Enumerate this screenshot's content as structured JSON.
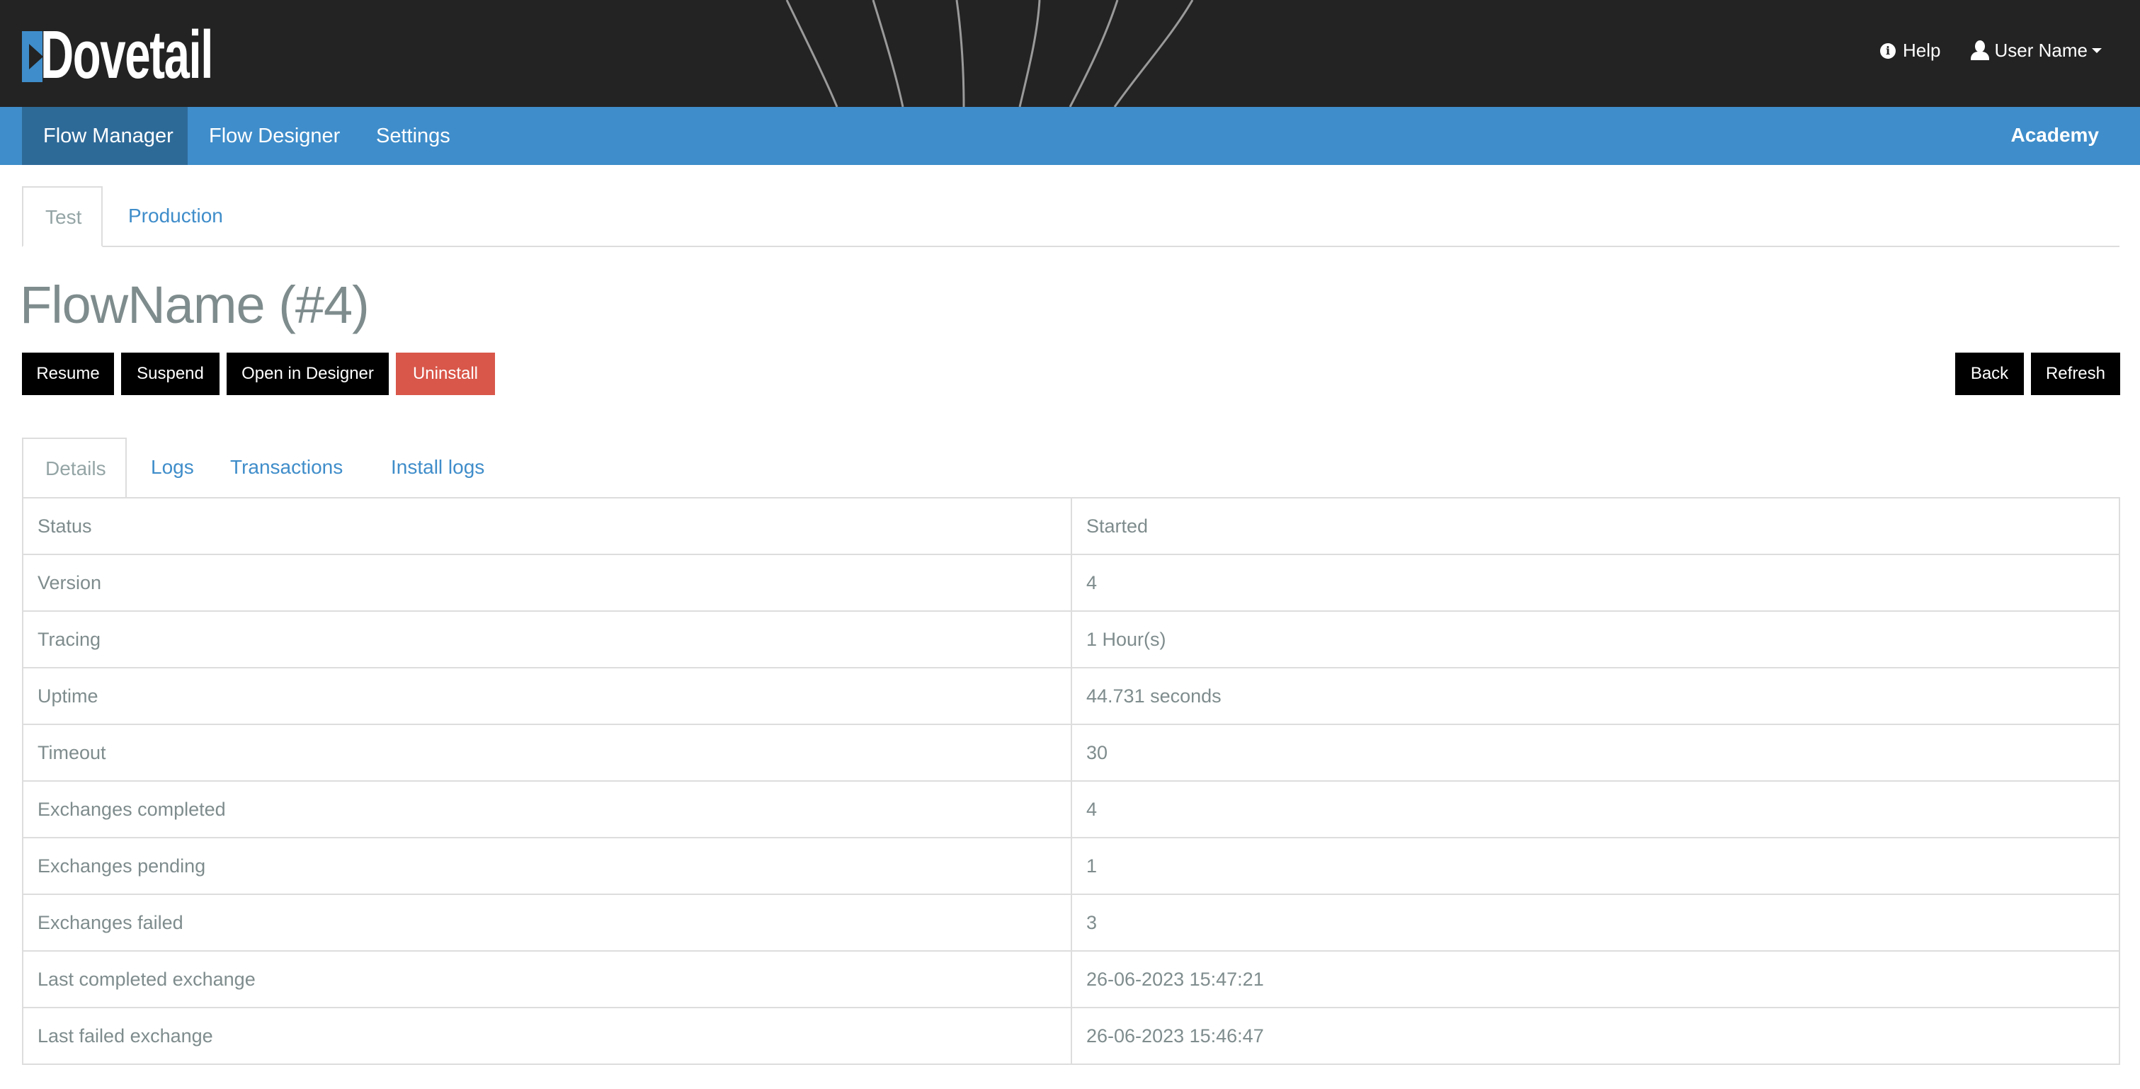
{
  "header": {
    "logo_text": "Dovetail",
    "help_label": "Help",
    "user_label": "User Name",
    "icons": {
      "help": "info-circle-icon",
      "user": "user-icon",
      "dropdown": "caret-down-icon"
    }
  },
  "navbar": {
    "items": [
      {
        "label": "Flow Manager",
        "active": true
      },
      {
        "label": "Flow Designer",
        "active": false
      },
      {
        "label": "Settings",
        "active": false
      }
    ],
    "right_label": "Academy"
  },
  "env_tabs": [
    {
      "label": "Test",
      "active": true
    },
    {
      "label": "Production",
      "active": false
    }
  ],
  "page": {
    "title": "FlowName (#4)"
  },
  "actions": {
    "left": [
      {
        "label": "Resume",
        "style": "dark"
      },
      {
        "label": "Suspend",
        "style": "dark"
      },
      {
        "label": "Open in Designer",
        "style": "dark"
      },
      {
        "label": "Uninstall",
        "style": "danger"
      }
    ],
    "right": [
      {
        "label": "Back",
        "style": "dark"
      },
      {
        "label": "Refresh",
        "style": "dark"
      }
    ]
  },
  "detail_tabs": [
    {
      "label": "Details",
      "active": true
    },
    {
      "label": "Logs",
      "active": false
    },
    {
      "label": "Transactions",
      "active": false
    },
    {
      "label": "Install logs",
      "active": false
    }
  ],
  "details": [
    {
      "label": "Status",
      "value": "Started"
    },
    {
      "label": "Version",
      "value": "4"
    },
    {
      "label": "Tracing",
      "value": "1 Hour(s)"
    },
    {
      "label": "Uptime",
      "value": "44.731 seconds"
    },
    {
      "label": "Timeout",
      "value": "30"
    },
    {
      "label": "Exchanges completed",
      "value": "4"
    },
    {
      "label": "Exchanges pending",
      "value": "1"
    },
    {
      "label": "Exchanges failed",
      "value": "3"
    },
    {
      "label": "Last completed exchange",
      "value": "26-06-2023 15:47:21"
    },
    {
      "label": "Last failed exchange",
      "value": "26-06-2023 15:46:47"
    }
  ],
  "colors": {
    "header_bg": "#232323",
    "nav_bg": "#3f8dca",
    "nav_active_bg": "#2e6a98",
    "link": "#3f8dca",
    "text_muted": "#7f8c8d",
    "button_dark": "#000000",
    "button_danger": "#d8574a",
    "border": "#dddddd"
  }
}
